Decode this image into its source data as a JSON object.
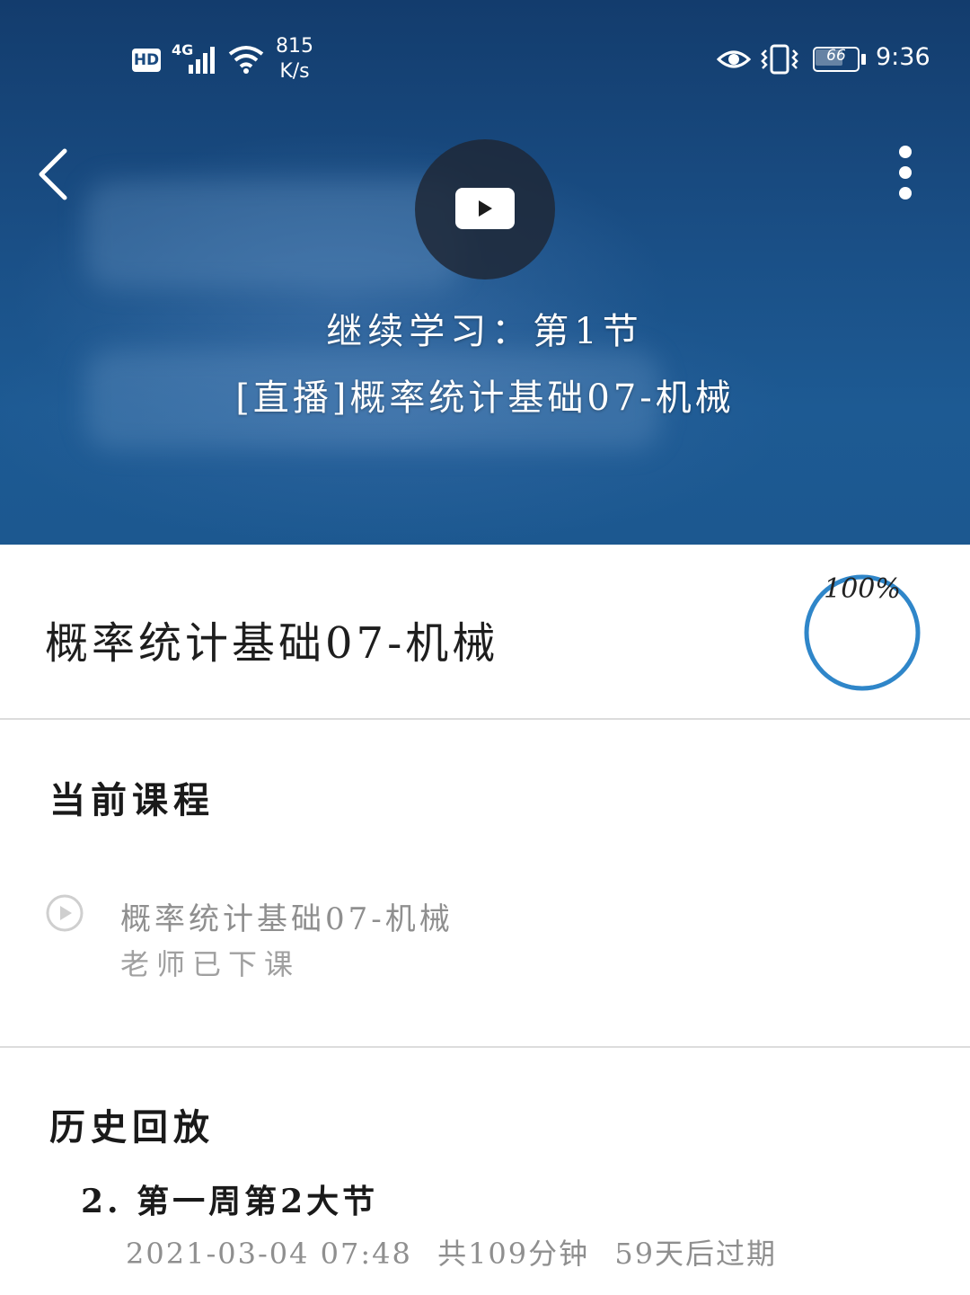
{
  "status_bar": {
    "hd_label": "HD",
    "network_label": "4G",
    "speed_value": "815",
    "speed_unit": "K/s",
    "battery_level": "66",
    "time": "9:36"
  },
  "video": {
    "continue_label": "继续学习：第1节",
    "lesson_title": "[直播]概率统计基础07-机械"
  },
  "course": {
    "title": "概率统计基础07-机械",
    "progress_label": "100%",
    "progress_fraction": 1.0,
    "accent_color": "#2f86c9"
  },
  "current_course": {
    "section_title": "当前课程",
    "item_name": "概率统计基础07-机械",
    "item_status": "老师已下课"
  },
  "history": {
    "section_title": "历史回放",
    "items": [
      {
        "title": "2. 第一周第2大节",
        "date": "2021-03-04 07:48",
        "duration": "共109分钟",
        "expiry": "59天后过期"
      }
    ]
  }
}
